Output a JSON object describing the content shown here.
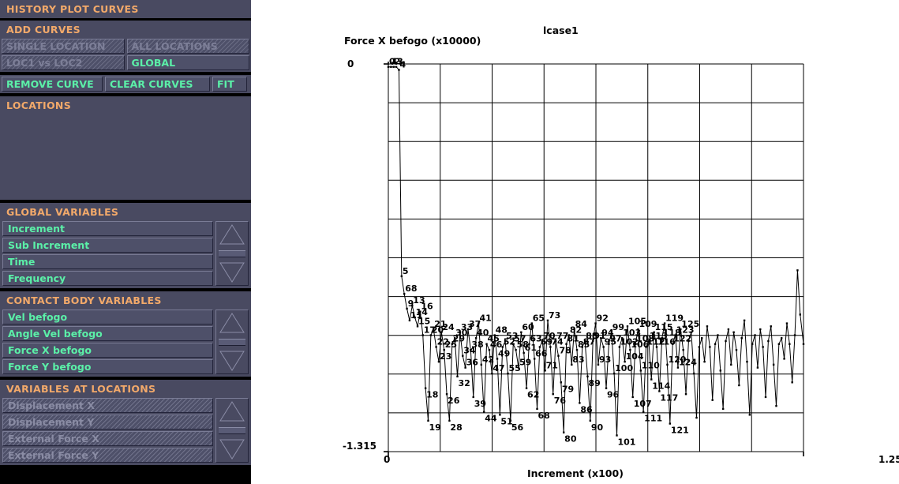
{
  "sidebar": {
    "title": "HISTORY PLOT CURVES",
    "add_curves": {
      "title": "ADD CURVES",
      "buttons": [
        {
          "label": "SINGLE LOCATION",
          "enabled": false
        },
        {
          "label": "ALL LOCATIONS",
          "enabled": false
        },
        {
          "label": "LOC1 vs LOC2",
          "enabled": false
        },
        {
          "label": "GLOBAL",
          "enabled": true
        }
      ]
    },
    "curve_actions": [
      {
        "label": "REMOVE CURVE",
        "enabled": true
      },
      {
        "label": "CLEAR CURVES",
        "enabled": true
      },
      {
        "label": "FIT",
        "enabled": true
      }
    ],
    "locations": {
      "title": "LOCATIONS",
      "items": []
    },
    "global_variables": {
      "title": "GLOBAL VARIABLES",
      "items": [
        {
          "label": "Increment",
          "enabled": true
        },
        {
          "label": "Sub Increment",
          "enabled": true
        },
        {
          "label": "Time",
          "enabled": true
        },
        {
          "label": "Frequency",
          "enabled": true
        }
      ]
    },
    "contact_body_variables": {
      "title": "CONTACT BODY VARIABLES",
      "items": [
        {
          "label": "Vel befogo",
          "enabled": true
        },
        {
          "label": "Angle Vel befogo",
          "enabled": true
        },
        {
          "label": "Force X befogo",
          "enabled": true
        },
        {
          "label": "Force Y befogo",
          "enabled": true
        }
      ]
    },
    "variables_at_locations": {
      "title": "VARIABLES AT LOCATIONS",
      "items": [
        {
          "label": "Displacement X",
          "enabled": false
        },
        {
          "label": "Displacement Y",
          "enabled": false
        },
        {
          "label": "External Force X",
          "enabled": false
        },
        {
          "label": "External Force Y",
          "enabled": false
        }
      ]
    },
    "colors": {
      "panel_bg": "#494a61",
      "button_face": "#4e5069",
      "accent_heading": "#f2a96a",
      "accent_label": "#5bf0a8",
      "disabled_label": "#8a8ca4",
      "window_bg": "#000000"
    }
  },
  "chart_data": {
    "type": "line",
    "title": "lcase1",
    "xlabel": "Increment (x100)",
    "ylabel": "Force X befogo (x10000)",
    "xlim": [
      0,
      1.25
    ],
    "ylim": [
      -1.315,
      0
    ],
    "xticks": [
      "0",
      "1.25"
    ],
    "yticks": [
      "0",
      "-1.315"
    ],
    "grid": true,
    "grid_cols": 8,
    "grid_rows": 10,
    "point_labels_shown": [
      "0",
      "1",
      "2",
      "3",
      "4",
      "5",
      "68",
      "9",
      "11",
      "13",
      "14",
      "15",
      "16",
      "17",
      "18",
      "19",
      "20",
      "21",
      "22",
      "23",
      "24",
      "25",
      "26",
      "28",
      "29",
      "30",
      "32",
      "33",
      "34",
      "36",
      "37",
      "38",
      "39",
      "40",
      "41",
      "42",
      "44",
      "45",
      "46",
      "47",
      "48",
      "49",
      "51",
      "52",
      "53",
      "55",
      "56",
      "57",
      "58",
      "59",
      "60",
      "61",
      "62",
      "63",
      "65",
      "66",
      "68",
      "69",
      "70",
      "71",
      "73",
      "74",
      "76",
      "77",
      "78",
      "79",
      "80",
      "81",
      "82",
      "83",
      "84",
      "85",
      "86",
      "87",
      "88",
      "89",
      "90",
      "91",
      "92",
      "93",
      "94",
      "95",
      "96",
      "97",
      "99",
      "100",
      "101",
      "102",
      "103",
      "104",
      "105",
      "106",
      "107",
      "108",
      "109",
      "110",
      "111",
      "112",
      "113",
      "114",
      "115",
      "116",
      "117",
      "118",
      "119",
      "120",
      "121",
      "122",
      "123",
      "124",
      "125"
    ],
    "series": [
      {
        "name": "Force X befogo",
        "marker": "square",
        "color": "#000000",
        "x": [
          0.0,
          0.008,
          0.016,
          0.024,
          0.032,
          0.04,
          0.048,
          0.056,
          0.064,
          0.072,
          0.08,
          0.088,
          0.096,
          0.104,
          0.112,
          0.12,
          0.128,
          0.136,
          0.144,
          0.152,
          0.16,
          0.168,
          0.176,
          0.184,
          0.192,
          0.2,
          0.208,
          0.216,
          0.224,
          0.232,
          0.24,
          0.248,
          0.256,
          0.264,
          0.272,
          0.28,
          0.288,
          0.296,
          0.304,
          0.312,
          0.32,
          0.328,
          0.336,
          0.344,
          0.352,
          0.36,
          0.368,
          0.376,
          0.384,
          0.392,
          0.4,
          0.408,
          0.416,
          0.424,
          0.432,
          0.44,
          0.448,
          0.456,
          0.464,
          0.472,
          0.48,
          0.488,
          0.496,
          0.504,
          0.512,
          0.52,
          0.528,
          0.536,
          0.544,
          0.552,
          0.56,
          0.568,
          0.576,
          0.584,
          0.592,
          0.6,
          0.608,
          0.616,
          0.624,
          0.632,
          0.64,
          0.648,
          0.656,
          0.664,
          0.672,
          0.68,
          0.688,
          0.696,
          0.704,
          0.712,
          0.72,
          0.728,
          0.736,
          0.744,
          0.752,
          0.76,
          0.768,
          0.776,
          0.784,
          0.792,
          0.8,
          0.808,
          0.816,
          0.824,
          0.832,
          0.84,
          0.848,
          0.856,
          0.864,
          0.872,
          0.88,
          0.888,
          0.896,
          0.904,
          0.912,
          0.92,
          0.928,
          0.936,
          0.944,
          0.952,
          0.96,
          0.968,
          0.976,
          0.984,
          0.992,
          1.0,
          1.008,
          1.016,
          1.024,
          1.032,
          1.04,
          1.048,
          1.056,
          1.064,
          1.072,
          1.08,
          1.088,
          1.096,
          1.104,
          1.112,
          1.12,
          1.128,
          1.136,
          1.144,
          1.152,
          1.16,
          1.168,
          1.176,
          1.184,
          1.192,
          1.2,
          1.208,
          1.216,
          1.224,
          1.232,
          1.24,
          1.25
        ],
        "y": [
          -0.01,
          -0.01,
          -0.01,
          -0.01,
          -0.02,
          -0.72,
          -0.78,
          -0.83,
          -0.87,
          -0.82,
          -0.86,
          -0.89,
          -0.84,
          -0.92,
          -1.1,
          -1.21,
          -0.92,
          -0.9,
          -0.96,
          -1.01,
          -0.91,
          -0.97,
          -1.12,
          -1.21,
          -0.95,
          -0.93,
          -1.06,
          -0.91,
          -0.99,
          -1.03,
          -0.9,
          -0.97,
          -1.13,
          -0.93,
          -0.88,
          -1.02,
          -1.18,
          -0.95,
          -0.97,
          -1.05,
          -0.92,
          -1.0,
          -1.19,
          -0.96,
          -0.94,
          -1.05,
          -1.21,
          -0.95,
          -0.97,
          -1.03,
          -0.91,
          -0.98,
          -1.1,
          -0.95,
          -0.88,
          -1.0,
          -1.17,
          -0.96,
          -0.94,
          -1.04,
          -0.87,
          -0.96,
          -1.12,
          -0.94,
          -0.99,
          -1.08,
          -1.25,
          -0.95,
          -0.92,
          -1.02,
          -0.9,
          -0.97,
          -1.15,
          -0.96,
          -0.94,
          -1.06,
          -1.21,
          -0.94,
          -0.88,
          -1.02,
          -0.93,
          -0.96,
          -1.1,
          -0.95,
          -0.91,
          -1.05,
          -1.26,
          -0.96,
          -0.93,
          -1.01,
          -0.89,
          -0.97,
          -1.13,
          -0.95,
          -0.9,
          -1.04,
          -1.18,
          -0.96,
          -0.94,
          -1.07,
          -0.91,
          -0.96,
          -1.11,
          -0.93,
          -0.88,
          -1.02,
          -1.22,
          -0.95,
          -0.92,
          -1.03,
          -0.9,
          -0.97,
          -1.12,
          -0.94,
          -0.91,
          -1.05,
          -1.2,
          -0.96,
          -0.93,
          -1.01,
          -0.89,
          -0.96,
          -1.14,
          -0.95,
          -0.92,
          -1.04,
          -1.17,
          -0.94,
          -0.9,
          -1.02,
          -0.91,
          -0.97,
          -1.09,
          -0.93,
          -0.87,
          -1.01,
          -1.19,
          -0.95,
          -0.92,
          -1.03,
          -0.9,
          -0.96,
          -1.13,
          -0.94,
          -0.89,
          -1.02,
          -1.16,
          -0.95,
          -0.93,
          -1.0,
          -0.88,
          -0.95,
          -1.08,
          -0.92,
          -0.7,
          -0.85,
          -0.95,
          -0.92,
          -0.88
        ]
      }
    ]
  }
}
